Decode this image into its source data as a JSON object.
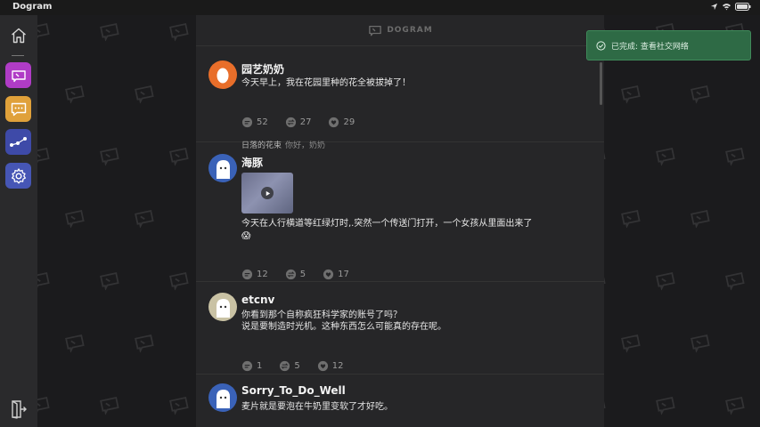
{
  "app": {
    "name": "Dogram"
  },
  "header": {
    "logo_text": "DOGRAM"
  },
  "toast": {
    "text": "已完成: 查看社交网络",
    "icon": "check-circle-icon"
  },
  "sidebar": {
    "items": [
      {
        "name": "home",
        "icon": "home-icon"
      },
      {
        "name": "feed",
        "icon": "dogram-logo-icon",
        "color": "#b03cc6"
      },
      {
        "name": "messages",
        "icon": "chat-icon",
        "color": "#e0a13a"
      },
      {
        "name": "network",
        "icon": "network-icon",
        "color": "#3e4aa8"
      },
      {
        "name": "settings",
        "icon": "gear-icon",
        "color": "#4656b5"
      }
    ],
    "logout_icon": "logout-icon"
  },
  "posts": [
    {
      "username": "园艺奶奶",
      "text": "今天早上，我在花园里种的花全被拔掉了！",
      "comments": "52",
      "reposts": "27",
      "likes": "29",
      "reply_user": "日落的花束",
      "reply_text": "你好，奶奶"
    },
    {
      "username": "海豚",
      "text": "今天在人行横道等红绿灯时,.突然一个传送门打开，一个女孩从里面出来了",
      "emoji": "😱",
      "comments": "12",
      "reposts": "5",
      "likes": "17"
    },
    {
      "username": "etcnv",
      "text_line1": "你看到那个自称疯狂科学家的账号了吗？",
      "text_line2": "说是要制造时光机。这种东西怎么可能真的存在呢。",
      "comments": "1",
      "reposts": "5",
      "likes": "12"
    },
    {
      "username": "Sorry_To_Do_Well",
      "text": "麦片就是要泡在牛奶里变软了才好吃。"
    }
  ]
}
